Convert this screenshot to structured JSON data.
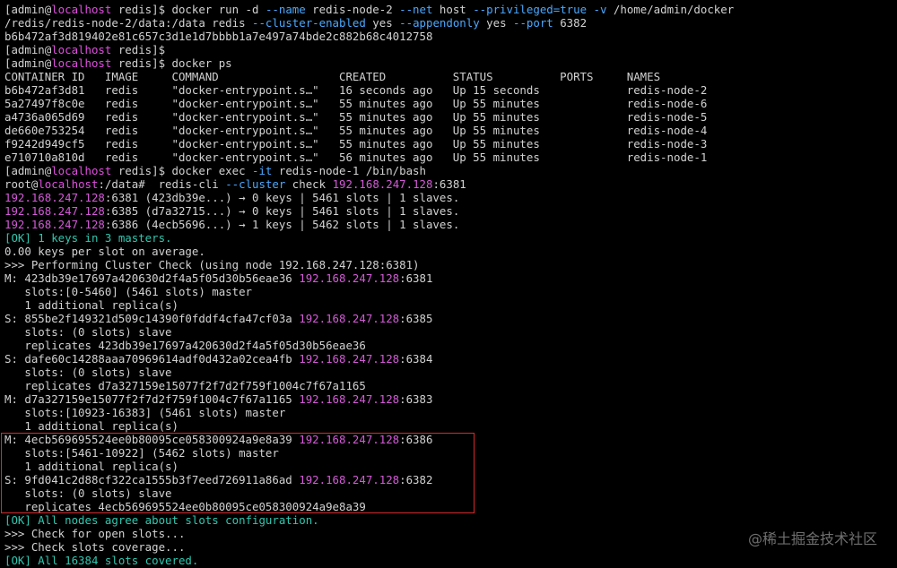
{
  "watermark": "@稀土掘金技术社区",
  "lines": [
    [
      {
        "t": "[admin@"
      },
      {
        "t": "localhost",
        "c": "host"
      },
      {
        "t": " redis]$ docker run -d "
      },
      {
        "t": "--name",
        "c": "flag"
      },
      {
        "t": " redis-node-2 "
      },
      {
        "t": "--net",
        "c": "flag"
      },
      {
        "t": " host "
      },
      {
        "t": "--privileged=true",
        "c": "flag"
      },
      {
        "t": " "
      },
      {
        "t": "-v",
        "c": "flag"
      },
      {
        "t": " /home/admin/docker"
      }
    ],
    [
      {
        "t": "/redis/redis-node-2/data:/data redis "
      },
      {
        "t": "--cluster-enabled",
        "c": "flag"
      },
      {
        "t": " yes "
      },
      {
        "t": "--appendonly",
        "c": "flag"
      },
      {
        "t": " yes "
      },
      {
        "t": "--port",
        "c": "flag"
      },
      {
        "t": " 6382"
      }
    ],
    [
      {
        "t": "b6b472af3d819402e81c657c3d1e1d7bbbb1a7e497a74bde2c882b68c4012758"
      }
    ],
    [
      {
        "t": "[admin@"
      },
      {
        "t": "localhost",
        "c": "host"
      },
      {
        "t": " redis]$"
      }
    ],
    [
      {
        "t": "[admin@"
      },
      {
        "t": "localhost",
        "c": "host"
      },
      {
        "t": " redis]$ docker ps"
      }
    ],
    [
      {
        "t": "CONTAINER ID   IMAGE     COMMAND                  CREATED          STATUS          PORTS     NAMES"
      }
    ],
    [
      {
        "t": "b6b472af3d81   redis     \"docker-entrypoint.s…\"   16 seconds ago   Up 15 seconds             redis-node-2"
      }
    ],
    [
      {
        "t": "5a27497f8c0e   redis     \"docker-entrypoint.s…\"   55 minutes ago   Up 55 minutes             redis-node-6"
      }
    ],
    [
      {
        "t": "a4736a065d69   redis     \"docker-entrypoint.s…\"   55 minutes ago   Up 55 minutes             redis-node-5"
      }
    ],
    [
      {
        "t": "de660e753254   redis     \"docker-entrypoint.s…\"   55 minutes ago   Up 55 minutes             redis-node-4"
      }
    ],
    [
      {
        "t": "f9242d949cf5   redis     \"docker-entrypoint.s…\"   55 minutes ago   Up 55 minutes             redis-node-3"
      }
    ],
    [
      {
        "t": "e710710a810d   redis     \"docker-entrypoint.s…\"   56 minutes ago   Up 55 minutes             redis-node-1"
      }
    ],
    [
      {
        "t": "[admin@"
      },
      {
        "t": "localhost",
        "c": "host"
      },
      {
        "t": " redis]$ docker exec "
      },
      {
        "t": "-it",
        "c": "flag"
      },
      {
        "t": " redis-node-1 /bin/bash"
      }
    ],
    [
      {
        "t": "root@"
      },
      {
        "t": "localhost",
        "c": "host"
      },
      {
        "t": ":/data#  redis-cli "
      },
      {
        "t": "--cluster",
        "c": "flag"
      },
      {
        "t": " check "
      },
      {
        "t": "192.168.247.128",
        "c": "ip"
      },
      {
        "t": ":6381"
      }
    ],
    [
      {
        "t": "192.168.247.128",
        "c": "ip"
      },
      {
        "t": ":6381 (423db39e...) → 0 keys | 5461 slots | 1 slaves."
      }
    ],
    [
      {
        "t": "192.168.247.128",
        "c": "ip"
      },
      {
        "t": ":6385 (d7a32715...) → 0 keys | 5461 slots | 1 slaves."
      }
    ],
    [
      {
        "t": "192.168.247.128",
        "c": "ip"
      },
      {
        "t": ":6386 (4ecb5696...) → 1 keys | 5462 slots | 1 slaves."
      }
    ],
    [
      {
        "t": "[OK] 1 keys in 3 masters.",
        "c": "ok"
      }
    ],
    [
      {
        "t": "0.00 keys per slot on average."
      }
    ],
    [
      {
        "t": ">>> Performing Cluster Check (using node 192.168.247.128:6381)"
      }
    ],
    [
      {
        "t": "M: 423db39e17697a420630d2f4a5f05d30b56eae36 "
      },
      {
        "t": "192.168.247.128",
        "c": "ip"
      },
      {
        "t": ":6381"
      }
    ],
    [
      {
        "t": "   slots:[0-5460] (5461 slots) master"
      }
    ],
    [
      {
        "t": "   1 additional replica(s)"
      }
    ],
    [
      {
        "t": "S: 855be2f149321d509c14390f0fddf4cfa47cf03a "
      },
      {
        "t": "192.168.247.128",
        "c": "ip"
      },
      {
        "t": ":6385"
      }
    ],
    [
      {
        "t": "   slots: (0 slots) slave"
      }
    ],
    [
      {
        "t": "   replicates 423db39e17697a420630d2f4a5f05d30b56eae36"
      }
    ],
    [
      {
        "t": "S: dafe60c14288aaa70969614adf0d432a02cea4fb "
      },
      {
        "t": "192.168.247.128",
        "c": "ip"
      },
      {
        "t": ":6384"
      }
    ],
    [
      {
        "t": "   slots: (0 slots) slave"
      }
    ],
    [
      {
        "t": "   replicates d7a327159e15077f2f7d2f759f1004c7f67a1165"
      }
    ],
    [
      {
        "t": "M: d7a327159e15077f2f7d2f759f1004c7f67a1165 "
      },
      {
        "t": "192.168.247.128",
        "c": "ip"
      },
      {
        "t": ":6383"
      }
    ],
    [
      {
        "t": "   slots:[10923-16383] (5461 slots) master"
      }
    ],
    [
      {
        "t": "   1 additional replica(s)"
      }
    ],
    [
      {
        "t": "M: 4ecb569695524ee0b80095ce058300924a9e8a39 "
      },
      {
        "t": "192.168.247.128",
        "c": "ip"
      },
      {
        "t": ":6386"
      }
    ],
    [
      {
        "t": "   slots:[5461-10922] (5462 slots) master"
      }
    ],
    [
      {
        "t": "   1 additional replica(s)"
      }
    ],
    [
      {
        "t": "S: 9fd041c2d88cf322ca1555b3f7eed726911a86ad "
      },
      {
        "t": "192.168.247.128",
        "c": "ip"
      },
      {
        "t": ":6382"
      }
    ],
    [
      {
        "t": "   slots: (0 slots) slave"
      }
    ],
    [
      {
        "t": "   replicates 4ecb569695524ee0b80095ce058300924a9e8a39"
      }
    ],
    [
      {
        "t": "[OK] All nodes agree about slots configuration.",
        "c": "ok"
      }
    ],
    [
      {
        "t": ">>> Check for open slots..."
      }
    ],
    [
      {
        "t": ">>> Check slots coverage..."
      }
    ],
    [
      {
        "t": "[OK] All 16384 slots covered.",
        "c": "ok"
      }
    ]
  ]
}
